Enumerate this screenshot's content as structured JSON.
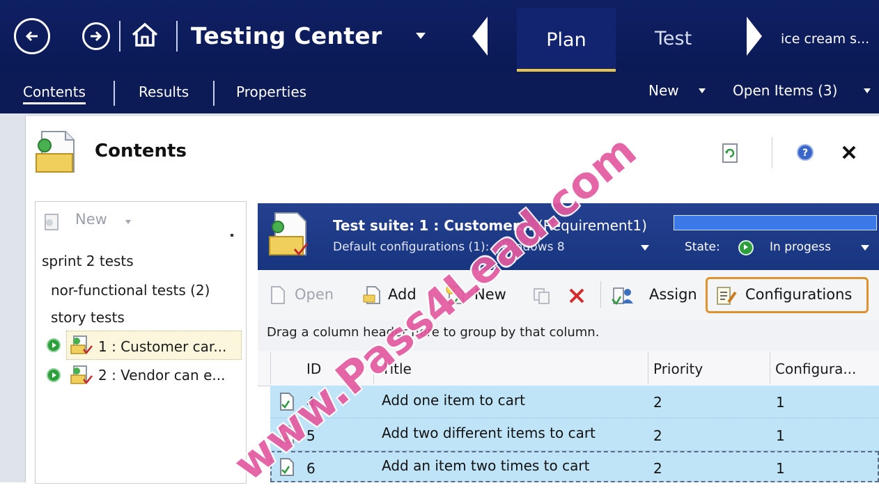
{
  "topbar": {
    "title": "Testing Center",
    "tabs": [
      {
        "label": "Plan",
        "active": true
      },
      {
        "label": "Test",
        "active": false
      }
    ],
    "context": "ice cream s...",
    "icons": [
      "back-arrow-icon",
      "forward-arrow-icon",
      "home-icon"
    ]
  },
  "subnav": {
    "links": [
      {
        "label": "Contents",
        "active": true
      },
      {
        "label": "Results",
        "active": false
      },
      {
        "label": "Properties",
        "active": false
      }
    ],
    "new_label": "New",
    "open_items_label": "Open Items (3)"
  },
  "contents": {
    "title": "Contents",
    "icons": [
      "refresh-icon",
      "help-icon",
      "close-icon"
    ]
  },
  "tree": {
    "new_label": "New",
    "items": [
      {
        "label": "sprint 2 tests",
        "level": 0
      },
      {
        "label": "nor-functional tests (2)",
        "level": 1
      },
      {
        "label": "story tests",
        "level": 1
      },
      {
        "label": "1 : Customer car...",
        "level": 1,
        "selected": true
      },
      {
        "label": "2 : Vendor can e...",
        "level": 1,
        "selected": false
      }
    ]
  },
  "suite": {
    "title_prefix": "Test suite:",
    "title_name": "1 : Customer...",
    "title_suffix": "(Requirement1)",
    "default_configs_label": "Default configurations (1):",
    "default_configs_value": "Windows 8",
    "state_label": "State:",
    "state_value": "In progess",
    "progress": 1.0
  },
  "toolbar": {
    "open": "Open",
    "add": "Add",
    "new": "New",
    "assign": "Assign",
    "configurations": "Configurations"
  },
  "grid": {
    "group_hint": "Drag a column header here to group by that column.",
    "columns": [
      "ID",
      "Title",
      "Priority",
      "Configura..."
    ],
    "rows": [
      {
        "id": "4",
        "title": "Add one item to cart",
        "priority": "2",
        "config": "1"
      },
      {
        "id": "5",
        "title": "Add two different items to cart",
        "priority": "2",
        "config": "1"
      },
      {
        "id": "6",
        "title": "Add an item two times to cart",
        "priority": "2",
        "config": "1"
      }
    ]
  },
  "watermark": "www.Pass4Lead.com",
  "colors": {
    "topbar": "#0f1f63",
    "suite_header": "#1f3a8a",
    "row_selected": "#bfe3f7",
    "highlight": "#e0922e",
    "watermark": "#e35aa0"
  }
}
